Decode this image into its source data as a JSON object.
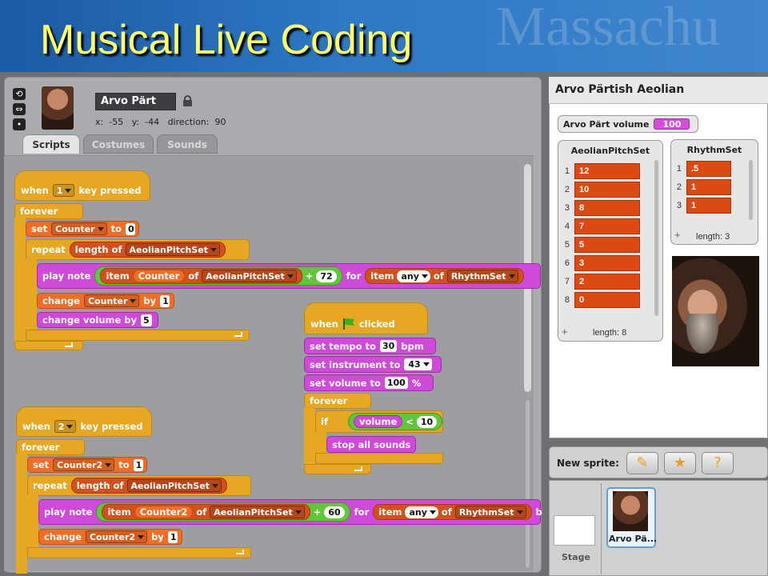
{
  "slide": {
    "title": "Musical Live Coding",
    "banner_watermark": "Massachu"
  },
  "sprite": {
    "name": "Arvo Pärt",
    "x_label": "x:",
    "x": "-55",
    "y_label": "y:",
    "y": "-44",
    "direction_label": "direction:",
    "direction": "90"
  },
  "tabs": [
    "Scripts",
    "Costumes",
    "Sounds"
  ],
  "scripts": {
    "s1": {
      "when": "when",
      "key": "1",
      "pressed": "key pressed",
      "forever": "forever",
      "set": "set",
      "set_var": "Counter",
      "to": "to",
      "set_val": "0",
      "repeat": "repeat",
      "length_of": "length of",
      "list": "AeolianPitchSet",
      "play_note": "play note",
      "item": "item",
      "item_var": "Counter",
      "of": "of",
      "plus": "+",
      "offset": "72",
      "for": "for",
      "item2": "item",
      "any": "any",
      "of2": "of",
      "rhythm": "RhythmSet",
      "change": "change",
      "change_var": "Counter",
      "by": "by",
      "by_val": "1",
      "change_vol": "change volume by",
      "vol_val": "5"
    },
    "s2": {
      "when": "when",
      "key": "2",
      "pressed": "key pressed",
      "forever": "forever",
      "set": "set",
      "set_var": "Counter2",
      "to": "to",
      "set_val": "1",
      "repeat": "repeat",
      "length_of": "length of",
      "list": "AeolianPitchSet",
      "play_note": "play note",
      "item": "item",
      "item_var": "Counter2",
      "of": "of",
      "plus": "+",
      "offset": "60",
      "for": "for",
      "item2": "item",
      "any": "any",
      "of2": "of",
      "rhythm": "RhythmSet",
      "tail": "b",
      "change": "change",
      "change_var": "Counter2",
      "by": "by",
      "by_val": "1"
    },
    "s3": {
      "when": "when",
      "clicked": "clicked",
      "set_tempo": "set tempo to",
      "tempo": "30",
      "bpm": "bpm",
      "set_instr": "set instrument to",
      "instr": "43",
      "set_vol": "set volume to",
      "vol": "100",
      "pct": "%",
      "forever": "forever",
      "if": "if",
      "volume": "volume",
      "lt": "<",
      "thresh": "10",
      "stop": "stop all sounds"
    }
  },
  "stage": {
    "title": "Arvo Pärtish Aeolian",
    "monitor_label": "Arvo Pärt volume",
    "monitor_value": "100",
    "pitch_list": {
      "title": "AeolianPitchSet",
      "items": [
        "12",
        "10",
        "8",
        "7",
        "5",
        "3",
        "2",
        "0"
      ],
      "indices": [
        "1",
        "2",
        "3",
        "4",
        "5",
        "6",
        "7",
        "8"
      ],
      "footer": "length: 8"
    },
    "rhythm_list": {
      "title": "RhythmSet",
      "items": [
        ".5",
        "1",
        "1"
      ],
      "indices": [
        "1",
        "2",
        "3"
      ],
      "footer": "length: 3"
    }
  },
  "sprites_panel": {
    "new_sprite": "New sprite:",
    "stage_label": "Stage",
    "selected_sprite": "Arvo Pä..."
  },
  "colors": {
    "control": "#e6a822",
    "variables": "#f16c25",
    "sound": "#cf4ad9",
    "operators": "#63c43d",
    "lists": "#d1501e",
    "title": "#ffff66"
  }
}
